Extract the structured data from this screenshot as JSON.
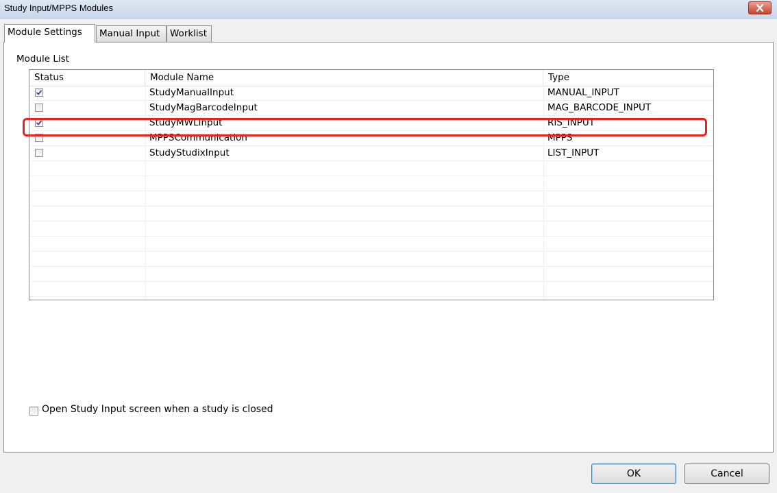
{
  "window": {
    "title": "Study Input/MPPS Modules"
  },
  "tabs": [
    {
      "label": "Module Settings",
      "active": true
    },
    {
      "label": "Manual Input",
      "active": false
    },
    {
      "label": "Worklist",
      "active": false
    }
  ],
  "module_list": {
    "group_label": "Module List",
    "columns": [
      "Status",
      "Module Name",
      "Type"
    ],
    "rows": [
      {
        "checked": true,
        "name": "StudyManualInput",
        "type": "MANUAL_INPUT"
      },
      {
        "checked": false,
        "name": "StudyMagBarcodeInput",
        "type": "MAG_BARCODE_INPUT"
      },
      {
        "checked": true,
        "name": "StudyMWLInput",
        "type": "RIS_INPUT",
        "highlighted": true
      },
      {
        "checked": false,
        "name": "MPPSCommunication",
        "type": "MPPS"
      },
      {
        "checked": false,
        "name": "StudyStudixInput",
        "type": "LIST_INPUT"
      }
    ]
  },
  "open_study_input": {
    "label": "Open Study Input screen when a study is closed",
    "checked": false
  },
  "buttons": {
    "ok": "OK",
    "cancel": "Cancel"
  },
  "colors": {
    "highlight": "#e8221d",
    "close_button": "#c5442e"
  },
  "icons": [
    "close-icon",
    "checkmark-icon"
  ]
}
